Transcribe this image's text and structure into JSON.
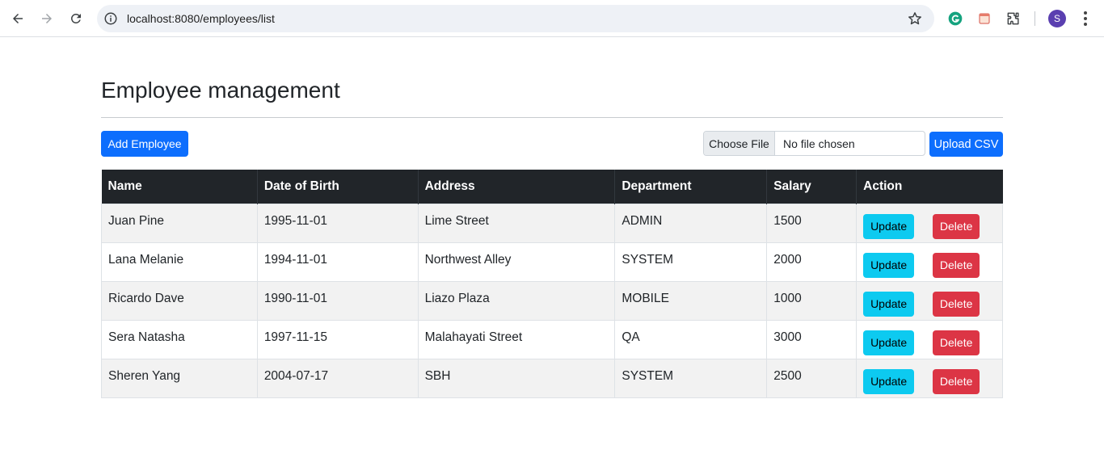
{
  "browser": {
    "url": "localhost:8080/employees/list",
    "avatar_letter": "S",
    "icons": [
      "back-arrow-icon",
      "forward-arrow-icon",
      "reload-icon",
      "site-info-icon",
      "bookmark-star-icon",
      "grammarly-extension-icon",
      "extension-icon",
      "puzzle-extensions-icon",
      "profile-avatar",
      "menu-dots-icon"
    ]
  },
  "page": {
    "title": "Employee management",
    "add_button": "Add Employee",
    "file_choose_label": "Choose File",
    "file_status": "No file chosen",
    "upload_button": "Upload CSV"
  },
  "table": {
    "headers": [
      "Name",
      "Date of Birth",
      "Address",
      "Department",
      "Salary",
      "Action"
    ],
    "rows": [
      {
        "name": "Juan Pine",
        "dob": "1995-11-01",
        "address": "Lime Street",
        "department": "ADMIN",
        "salary": "1500"
      },
      {
        "name": "Lana Melanie",
        "dob": "1994-11-01",
        "address": "Northwest Alley",
        "department": "SYSTEM",
        "salary": "2000"
      },
      {
        "name": "Ricardo Dave",
        "dob": "1990-11-01",
        "address": "Liazo Plaza",
        "department": "MOBILE",
        "salary": "1000"
      },
      {
        "name": "Sera Natasha",
        "dob": "1997-11-15",
        "address": "Malahayati Street",
        "department": "QA",
        "salary": "3000"
      },
      {
        "name": "Sheren Yang",
        "dob": "2004-07-17",
        "address": "SBH",
        "department": "SYSTEM",
        "salary": "2500"
      }
    ],
    "update_label": "Update",
    "delete_label": "Delete"
  },
  "colors": {
    "primary": "#0d6efd",
    "info": "#0dcaf0",
    "danger": "#dc3545",
    "table_header": "#212529"
  }
}
